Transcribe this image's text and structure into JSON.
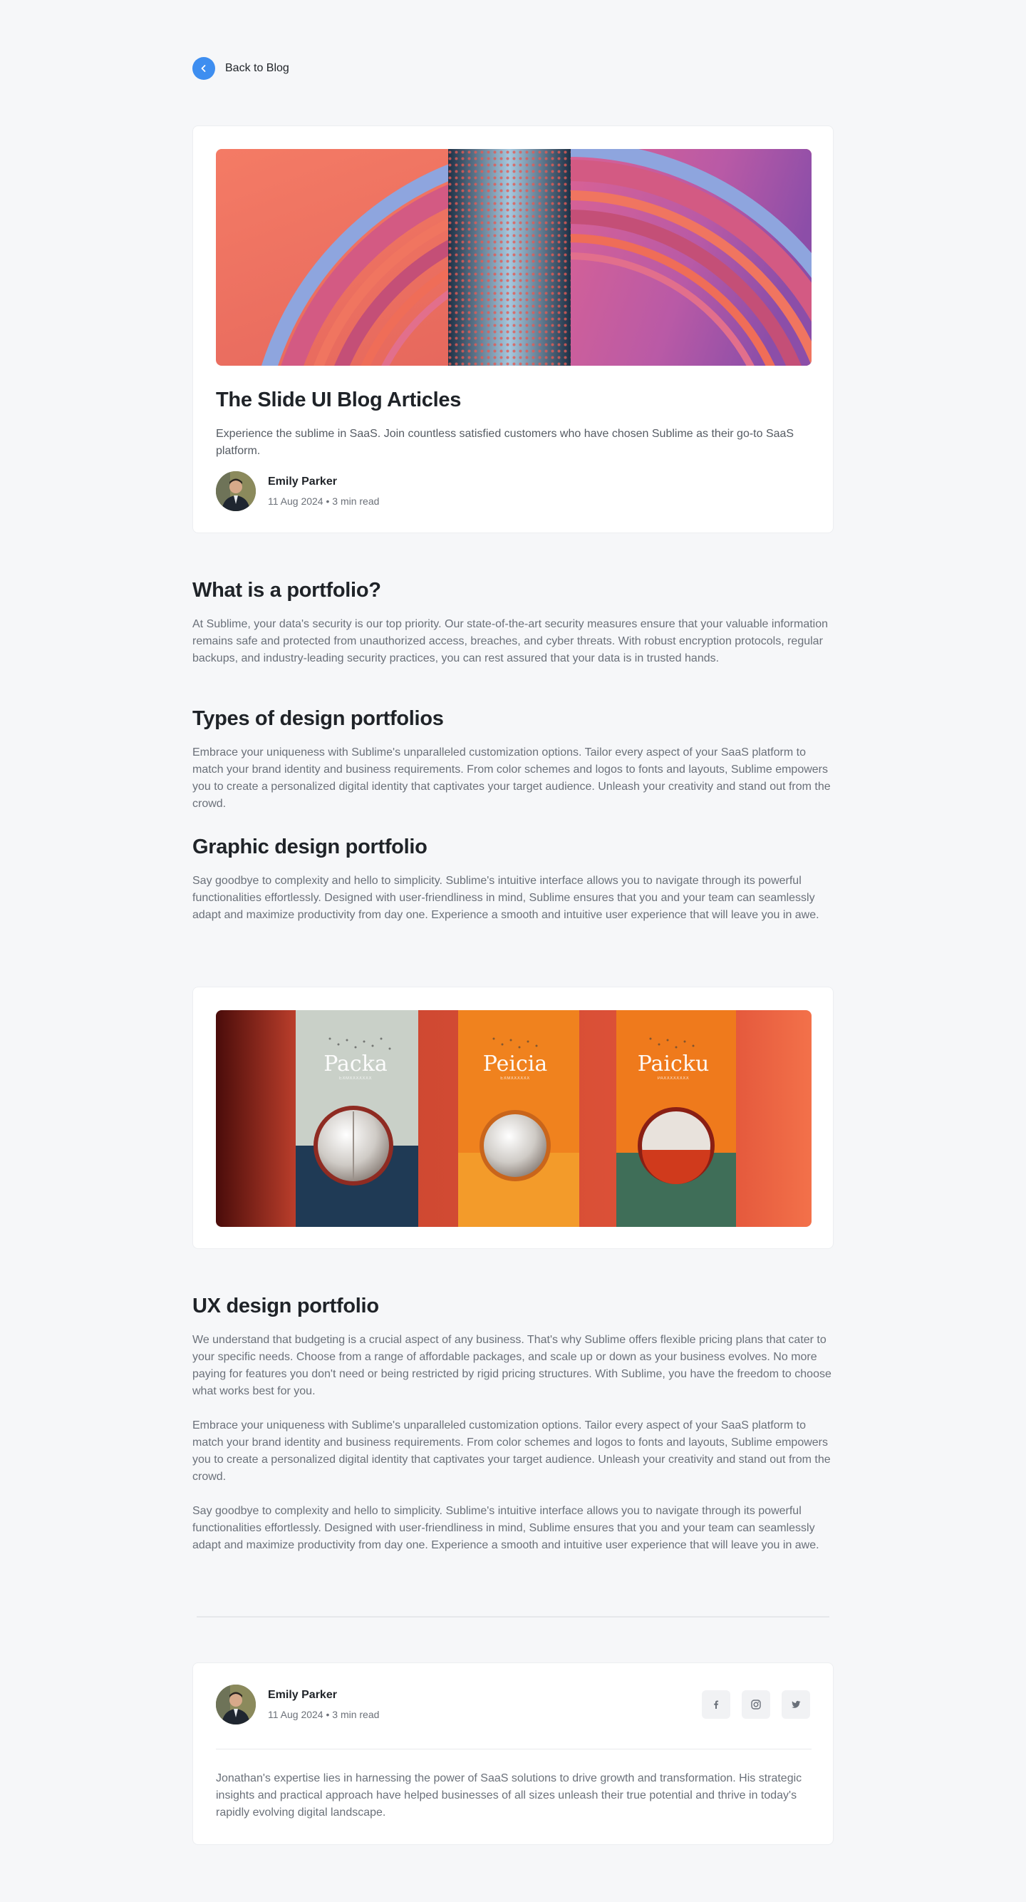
{
  "nav": {
    "back_label": "Back to Blog"
  },
  "hero": {
    "title": "The Slide UI Blog Articles",
    "description": "Experience the sublime in SaaS. Join countless satisfied customers who have chosen Sublime as their go-to SaaS platform.",
    "author": {
      "name": "Emily Parker",
      "meta": "11 Aug 2024 • 3 min read"
    }
  },
  "article": {
    "sections": [
      {
        "heading": "What is a portfolio?",
        "body": "At Sublime, your data's security is our top priority. Our state-of-the-art security measures ensure that your valuable information remains safe and protected from unauthorized access, breaches, and cyber threats. With robust encryption protocols, regular backups, and industry-leading security practices, you can rest assured that your data is in trusted hands."
      },
      {
        "heading": "Types of design portfolios",
        "body": "Embrace your uniqueness with Sublime's unparalleled customization options. Tailor every aspect of your SaaS platform to match your brand identity and business requirements. From color schemes and logos to fonts and layouts, Sublime empowers you to create a personalized digital identity that captivates your target audience. Unleash your creativity and stand out from the crowd."
      },
      {
        "heading": "Graphic design portfolio",
        "body": "Say goodbye to complexity and hello to simplicity. Sublime's intuitive interface allows you to navigate through its powerful functionalities effortlessly. Designed with user-friendliness in mind, Sublime ensures that you and your team can seamlessly adapt and maximize productivity from day one. Experience a smooth and intuitive user experience that will leave you in awe."
      }
    ],
    "ux": {
      "heading": "UX design portfolio",
      "paragraphs": [
        "We understand that budgeting is a crucial aspect of any business. That's why Sublime offers flexible pricing plans that cater to your specific needs. Choose from a range of affordable packages, and scale up or down as your business evolves. No more paying for features you don't need or being restricted by rigid pricing structures. With Sublime, you have the freedom to choose what works best for you.",
        "Embrace your uniqueness with Sublime's unparalleled customization options. Tailor every aspect of your SaaS platform to match your brand identity and business requirements. From color schemes and logos to fonts and layouts, Sublime empowers you to create a personalized digital identity that captivates your target audience. Unleash your creativity and stand out from the crowd.",
        "Say goodbye to complexity and hello to simplicity. Sublime's intuitive interface allows you to navigate through its powerful functionalities effortlessly. Designed with user-friendliness in mind, Sublime ensures that you and your team can seamlessly adapt and maximize productivity from day one. Experience a smooth and intuitive user experience that will leave you in awe."
      ]
    }
  },
  "product_image": {
    "labels": [
      "Packa",
      "Peicia",
      "Paicku"
    ],
    "sublabels": [
      "EXMXXXXXXX",
      "EXMXXXXXX",
      "PAXXXXXXXX"
    ]
  },
  "bio": {
    "author": {
      "name": "Emily Parker",
      "meta": "11 Aug 2024 • 3 min read"
    },
    "text": "Jonathan's expertise lies in harnessing the power of SaaS solutions to drive growth and transformation. His strategic insights and practical approach have helped businesses of all sizes unleash their true potential and thrive in today's rapidly evolving digital landscape.",
    "socials": [
      "facebook-icon",
      "instagram-icon",
      "twitter-icon"
    ]
  },
  "colors": {
    "accent": "#3e8ef0",
    "background": "#f6f7f9",
    "heading": "#1f2328",
    "body": "#6a7079"
  }
}
